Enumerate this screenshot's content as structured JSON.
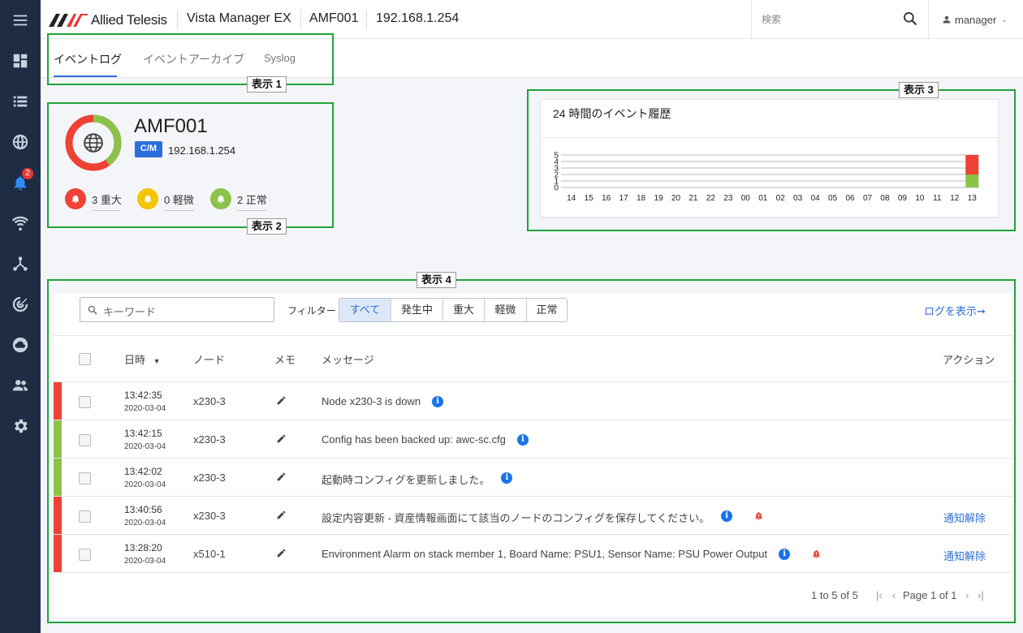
{
  "app": {
    "brand": "Allied Telesis",
    "product": "Vista Manager EX",
    "node": "AMF001",
    "ip": "192.168.1.254"
  },
  "search": {
    "placeholder": "検索"
  },
  "user": {
    "name": "manager"
  },
  "sidebar": {
    "items": [
      {
        "icon": "menu-icon"
      },
      {
        "icon": "dashboard-icon"
      },
      {
        "icon": "list-icon"
      },
      {
        "icon": "globe-icon"
      },
      {
        "icon": "bell-icon",
        "badge": "2",
        "active": true
      },
      {
        "icon": "wifi-icon"
      },
      {
        "icon": "topology-icon"
      },
      {
        "icon": "radar-icon"
      },
      {
        "icon": "cloud-icon"
      },
      {
        "icon": "users-icon"
      },
      {
        "icon": "settings-icon"
      }
    ]
  },
  "tabs": [
    "イベントログ",
    "イベントアーカイブ",
    "Syslog"
  ],
  "callouts": {
    "c1": "表示 1",
    "c2": "表示 2",
    "c3": "表示 3",
    "c4": "表示 4"
  },
  "node_card": {
    "name": "AMF001",
    "badge": "C/M",
    "ip": "192.168.1.254",
    "critical": "3 重大",
    "minor": "0 軽微",
    "normal": "2 正常",
    "colors": {
      "critical": "#ef4136",
      "minor": "#f5c400",
      "normal": "#8bc34a"
    }
  },
  "chart": {
    "title": "24 時間のイベント履歴"
  },
  "chart_data": {
    "type": "bar",
    "title": "24 時間のイベント履歴",
    "categories": [
      "14",
      "15",
      "16",
      "17",
      "18",
      "19",
      "20",
      "21",
      "22",
      "23",
      "00",
      "01",
      "02",
      "03",
      "04",
      "05",
      "06",
      "07",
      "08",
      "09",
      "10",
      "11",
      "12",
      "13"
    ],
    "series": [
      {
        "values": [
          0,
          0,
          0,
          0,
          0,
          0,
          0,
          0,
          0,
          0,
          0,
          0,
          0,
          0,
          0,
          0,
          0,
          0,
          0,
          0,
          0,
          0,
          0,
          2
        ],
        "color": "#8bc34a"
      },
      {
        "values": [
          0,
          0,
          0,
          0,
          0,
          0,
          0,
          0,
          0,
          0,
          0,
          0,
          0,
          0,
          0,
          0,
          0,
          0,
          0,
          0,
          0,
          0,
          0,
          3
        ],
        "color": "#ef4136"
      }
    ],
    "yticks": [
      "0",
      "1",
      "2",
      "3",
      "4",
      "5"
    ],
    "ylim": [
      0,
      5
    ],
    "stacked": true
  },
  "events": {
    "keyword_placeholder": "キーワード",
    "filter_label": "フィルター",
    "filters": [
      "すべて",
      "発生中",
      "重大",
      "軽微",
      "正常"
    ],
    "log_link": "ログを表示➞",
    "columns": {
      "datetime": "日時",
      "node": "ノード",
      "memo": "メモ",
      "message": "メッセージ",
      "action": "アクション"
    },
    "rows": [
      {
        "time": "13:42:35",
        "date": "2020-03-04",
        "node": "x230-3",
        "message": "Node x230-3 is down",
        "severity": "critical",
        "alarm": false,
        "action": ""
      },
      {
        "time": "13:42:15",
        "date": "2020-03-04",
        "node": "x230-3",
        "message": "Config has been backed up: awc-sc.cfg",
        "severity": "normal",
        "alarm": false,
        "action": ""
      },
      {
        "time": "13:42:02",
        "date": "2020-03-04",
        "node": "x230-3",
        "message": "起動時コンフィグを更新しました。",
        "severity": "normal",
        "alarm": false,
        "action": ""
      },
      {
        "time": "13:40:56",
        "date": "2020-03-04",
        "node": "x230-3",
        "message": "設定内容更新 - 資産情報画面にて該当のノードのコンフィグを保存してください。",
        "severity": "critical",
        "alarm": true,
        "action": "通知解除"
      },
      {
        "time": "13:28:20",
        "date": "2020-03-04",
        "node": "x510-1",
        "message": "Environment Alarm on stack member 1, Board Name: PSU1, Sensor Name: PSU Power Output",
        "severity": "critical",
        "alarm": true,
        "action": "通知解除"
      }
    ],
    "pager": {
      "range": "1 to 5 of 5",
      "page": "Page 1 of 1"
    }
  }
}
